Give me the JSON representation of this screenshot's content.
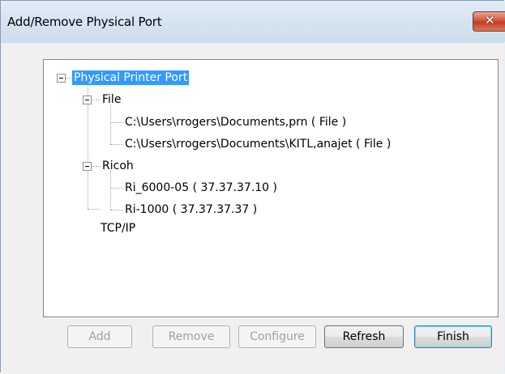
{
  "window": {
    "title": "Add/Remove Physical Port",
    "close_glyph": "✕"
  },
  "tree": {
    "root": "Physical Printer Port",
    "file_group": "File",
    "file_items": [
      "C:\\Users\\rrogers\\Documents,prn ( File )",
      "C:\\Users\\rrogers\\Documents\\KITL,anajet ( File )"
    ],
    "ricoh_group": "Ricoh",
    "ricoh_items": [
      "Ri_6000-05 ( 37.37.37.10 )",
      "Ri-1000 ( 37.37.37.37 )"
    ],
    "tcpip": "TCP/IP"
  },
  "buttons": {
    "add": "Add",
    "remove": "Remove",
    "configure": "Configure",
    "refresh": "Refresh",
    "finish": "Finish"
  },
  "colors": {
    "selection": "#3399ff",
    "close": "#c43a20"
  }
}
